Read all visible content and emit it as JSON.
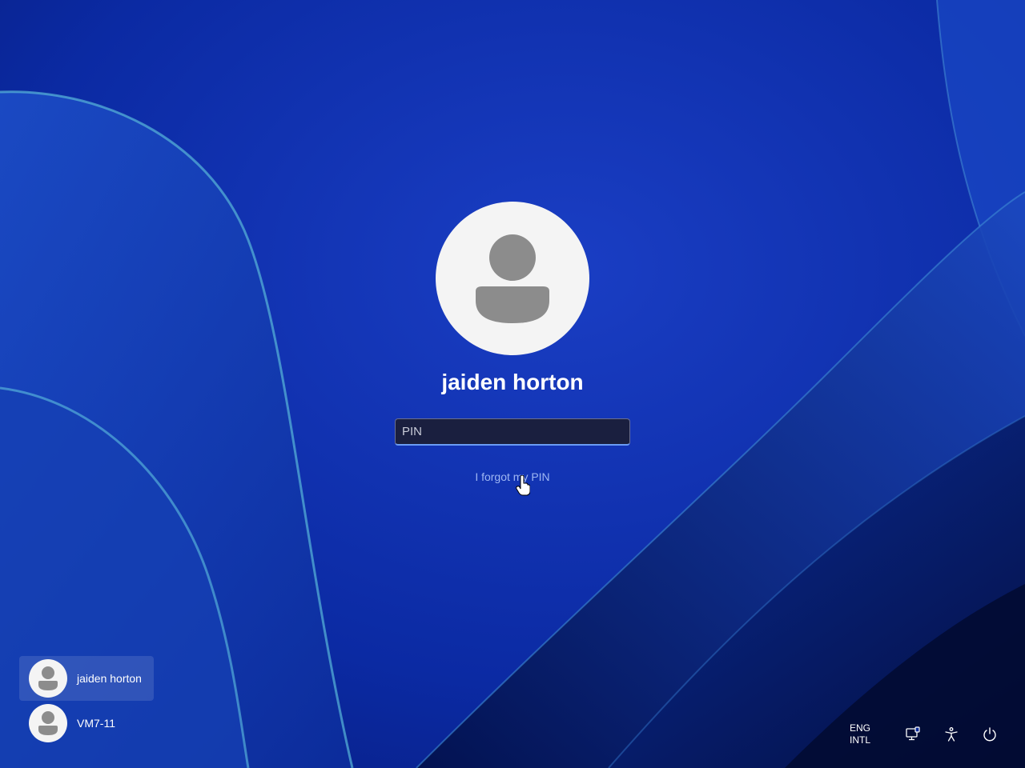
{
  "login": {
    "username": "jaiden horton",
    "pin_placeholder": "PIN",
    "pin_value": "",
    "forgot_pin_label": "I forgot my PIN"
  },
  "user_switcher": [
    {
      "name": "jaiden horton",
      "selected": true,
      "icon": "user-avatar-icon"
    },
    {
      "name": "VM7-11",
      "selected": false,
      "icon": "user-avatar-icon"
    }
  ],
  "tray": {
    "language_line1": "ENG",
    "language_line2": "INTL",
    "icons": [
      "network-icon",
      "accessibility-icon",
      "power-icon"
    ]
  },
  "colors": {
    "background": "#0a2a9a",
    "text": "#ffffff",
    "link": "#9fb7f3",
    "avatar_bg": "#f4f4f4",
    "avatar_glyph": "#8c8c8c",
    "input_focus": "#6a9cf5"
  }
}
